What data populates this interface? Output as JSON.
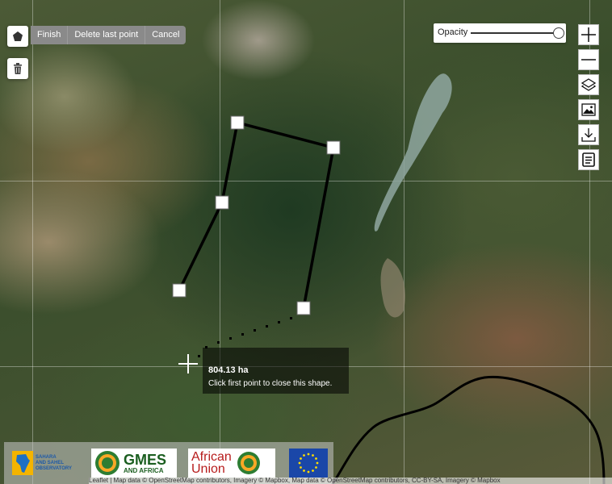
{
  "draw_toolbar": {
    "finish": "Finish",
    "delete_last_point": "Delete last point",
    "cancel": "Cancel"
  },
  "icons": {
    "polygon": "pentagon-icon",
    "trash": "trash-icon",
    "zoom_in": "plus-icon",
    "zoom_out": "minus-icon",
    "layers": "layers-icon",
    "image": "image-icon",
    "download": "download-icon",
    "legend": "document-icon"
  },
  "opacity": {
    "label": "Opacity",
    "value": 1.0
  },
  "measurement": {
    "area": "804.13 ha",
    "hint": "Click first point to close this shape."
  },
  "logos": {
    "sass_line1": "SAHARA",
    "sass_line2": "AND SAHEL",
    "sass_line3": "OBSERVATORY",
    "gmes_line1": "GMES",
    "gmes_line2": "AND AFRICA",
    "au_line1": "African",
    "au_line2": "Union"
  },
  "attribution": "Leaflet | Map data © OpenStreetMap contributors, Imagery © Mapbox, Map data © OpenStreetMap contributors, CC-BY-SA, Imagery © Mapbox",
  "colors": {
    "toolbar_bg": "#8a8a8a",
    "line": "#000000",
    "vertex": "#ffffff"
  }
}
